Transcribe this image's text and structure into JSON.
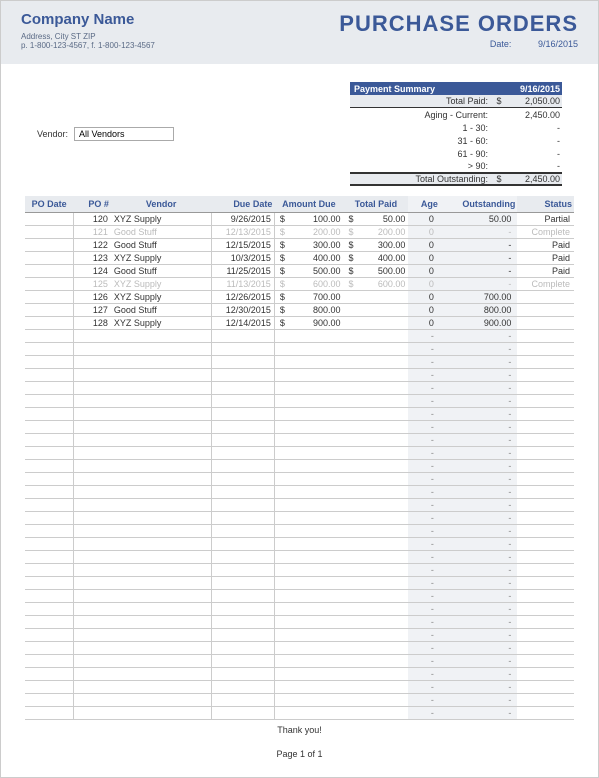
{
  "header": {
    "company_name": "Company Name",
    "address": "Address, City ST ZIP",
    "phone": "p. 1-800-123-4567, f. 1-800-123-4567",
    "title": "PURCHASE ORDERS",
    "date_label": "Date:",
    "date_value": "9/16/2015"
  },
  "filter": {
    "vendor_label": "Vendor:",
    "vendor_value": "All Vendors"
  },
  "summary": {
    "header_label": "Payment Summary",
    "header_date": "9/16/2015",
    "total_paid_label": "Total Paid:",
    "total_paid_cur": "$",
    "total_paid_val": "2,050.00",
    "aging_current_label": "Aging - Current:",
    "aging_current_val": "2,450.00",
    "r1_label": "1 - 30:",
    "r1_val": "-",
    "r2_label": "31 - 60:",
    "r2_val": "-",
    "r3_label": "61 - 90:",
    "r3_val": "-",
    "r4_label": "> 90:",
    "r4_val": "-",
    "outstanding_label": "Total Outstanding:",
    "outstanding_cur": "$",
    "outstanding_val": "2,450.00"
  },
  "table": {
    "headers": {
      "podate": "PO Date",
      "ponum": "PO #",
      "vendor": "Vendor",
      "due": "Due Date",
      "amount": "Amount Due",
      "paid": "Total Paid",
      "age": "Age",
      "outstanding": "Outstanding",
      "status": "Status"
    },
    "rows": [
      {
        "faded": false,
        "ponum": "120",
        "vendor": "XYZ Supply",
        "due": "9/26/2015",
        "amt": "100.00",
        "paid": "50.00",
        "age": "0",
        "out": "50.00",
        "status": "Partial"
      },
      {
        "faded": true,
        "ponum": "121",
        "vendor": "Good Stuff",
        "due": "12/13/2015",
        "amt": "200.00",
        "paid": "200.00",
        "age": "0",
        "out": "-",
        "status": "Complete"
      },
      {
        "faded": false,
        "ponum": "122",
        "vendor": "Good Stuff",
        "due": "12/15/2015",
        "amt": "300.00",
        "paid": "300.00",
        "age": "0",
        "out": "-",
        "status": "Paid"
      },
      {
        "faded": false,
        "ponum": "123",
        "vendor": "XYZ Supply",
        "due": "10/3/2015",
        "amt": "400.00",
        "paid": "400.00",
        "age": "0",
        "out": "-",
        "status": "Paid"
      },
      {
        "faded": false,
        "ponum": "124",
        "vendor": "Good Stuff",
        "due": "11/25/2015",
        "amt": "500.00",
        "paid": "500.00",
        "age": "0",
        "out": "-",
        "status": "Paid"
      },
      {
        "faded": true,
        "ponum": "125",
        "vendor": "XYZ Supply",
        "due": "11/13/2015",
        "amt": "600.00",
        "paid": "600.00",
        "age": "0",
        "out": "-",
        "status": "Complete"
      },
      {
        "faded": false,
        "ponum": "126",
        "vendor": "XYZ Supply",
        "due": "12/26/2015",
        "amt": "700.00",
        "paid": "",
        "age": "0",
        "out": "700.00",
        "status": ""
      },
      {
        "faded": false,
        "ponum": "127",
        "vendor": "Good Stuff",
        "due": "12/30/2015",
        "amt": "800.00",
        "paid": "",
        "age": "0",
        "out": "800.00",
        "status": ""
      },
      {
        "faded": false,
        "ponum": "128",
        "vendor": "XYZ Supply",
        "due": "12/14/2015",
        "amt": "900.00",
        "paid": "",
        "age": "0",
        "out": "900.00",
        "status": ""
      }
    ],
    "empty_rows": 30
  },
  "footer": {
    "thanks": "Thank you!",
    "page": "Page 1 of 1"
  }
}
